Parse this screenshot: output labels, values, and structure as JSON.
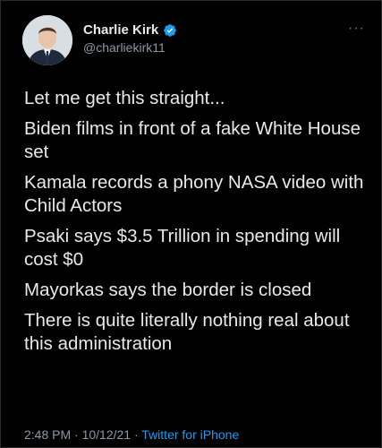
{
  "author": {
    "display_name": "Charlie Kirk",
    "handle": "@charliekirk11",
    "verified": true,
    "verified_color": "#1d9bf0"
  },
  "more_label": "···",
  "tweet": {
    "lines": [
      "Let me get this straight...",
      "Biden films in front of a fake White House set",
      "Kamala records a phony NASA video with Child Actors",
      "Psaki says $3.5 Trillion in spending will cost $0",
      "Mayorkas says the border is closed",
      "There is quite literally nothing real about this administration"
    ]
  },
  "meta": {
    "time": "2:48 PM",
    "separator": " · ",
    "date": "10/12/21",
    "source": "Twitter for iPhone"
  }
}
